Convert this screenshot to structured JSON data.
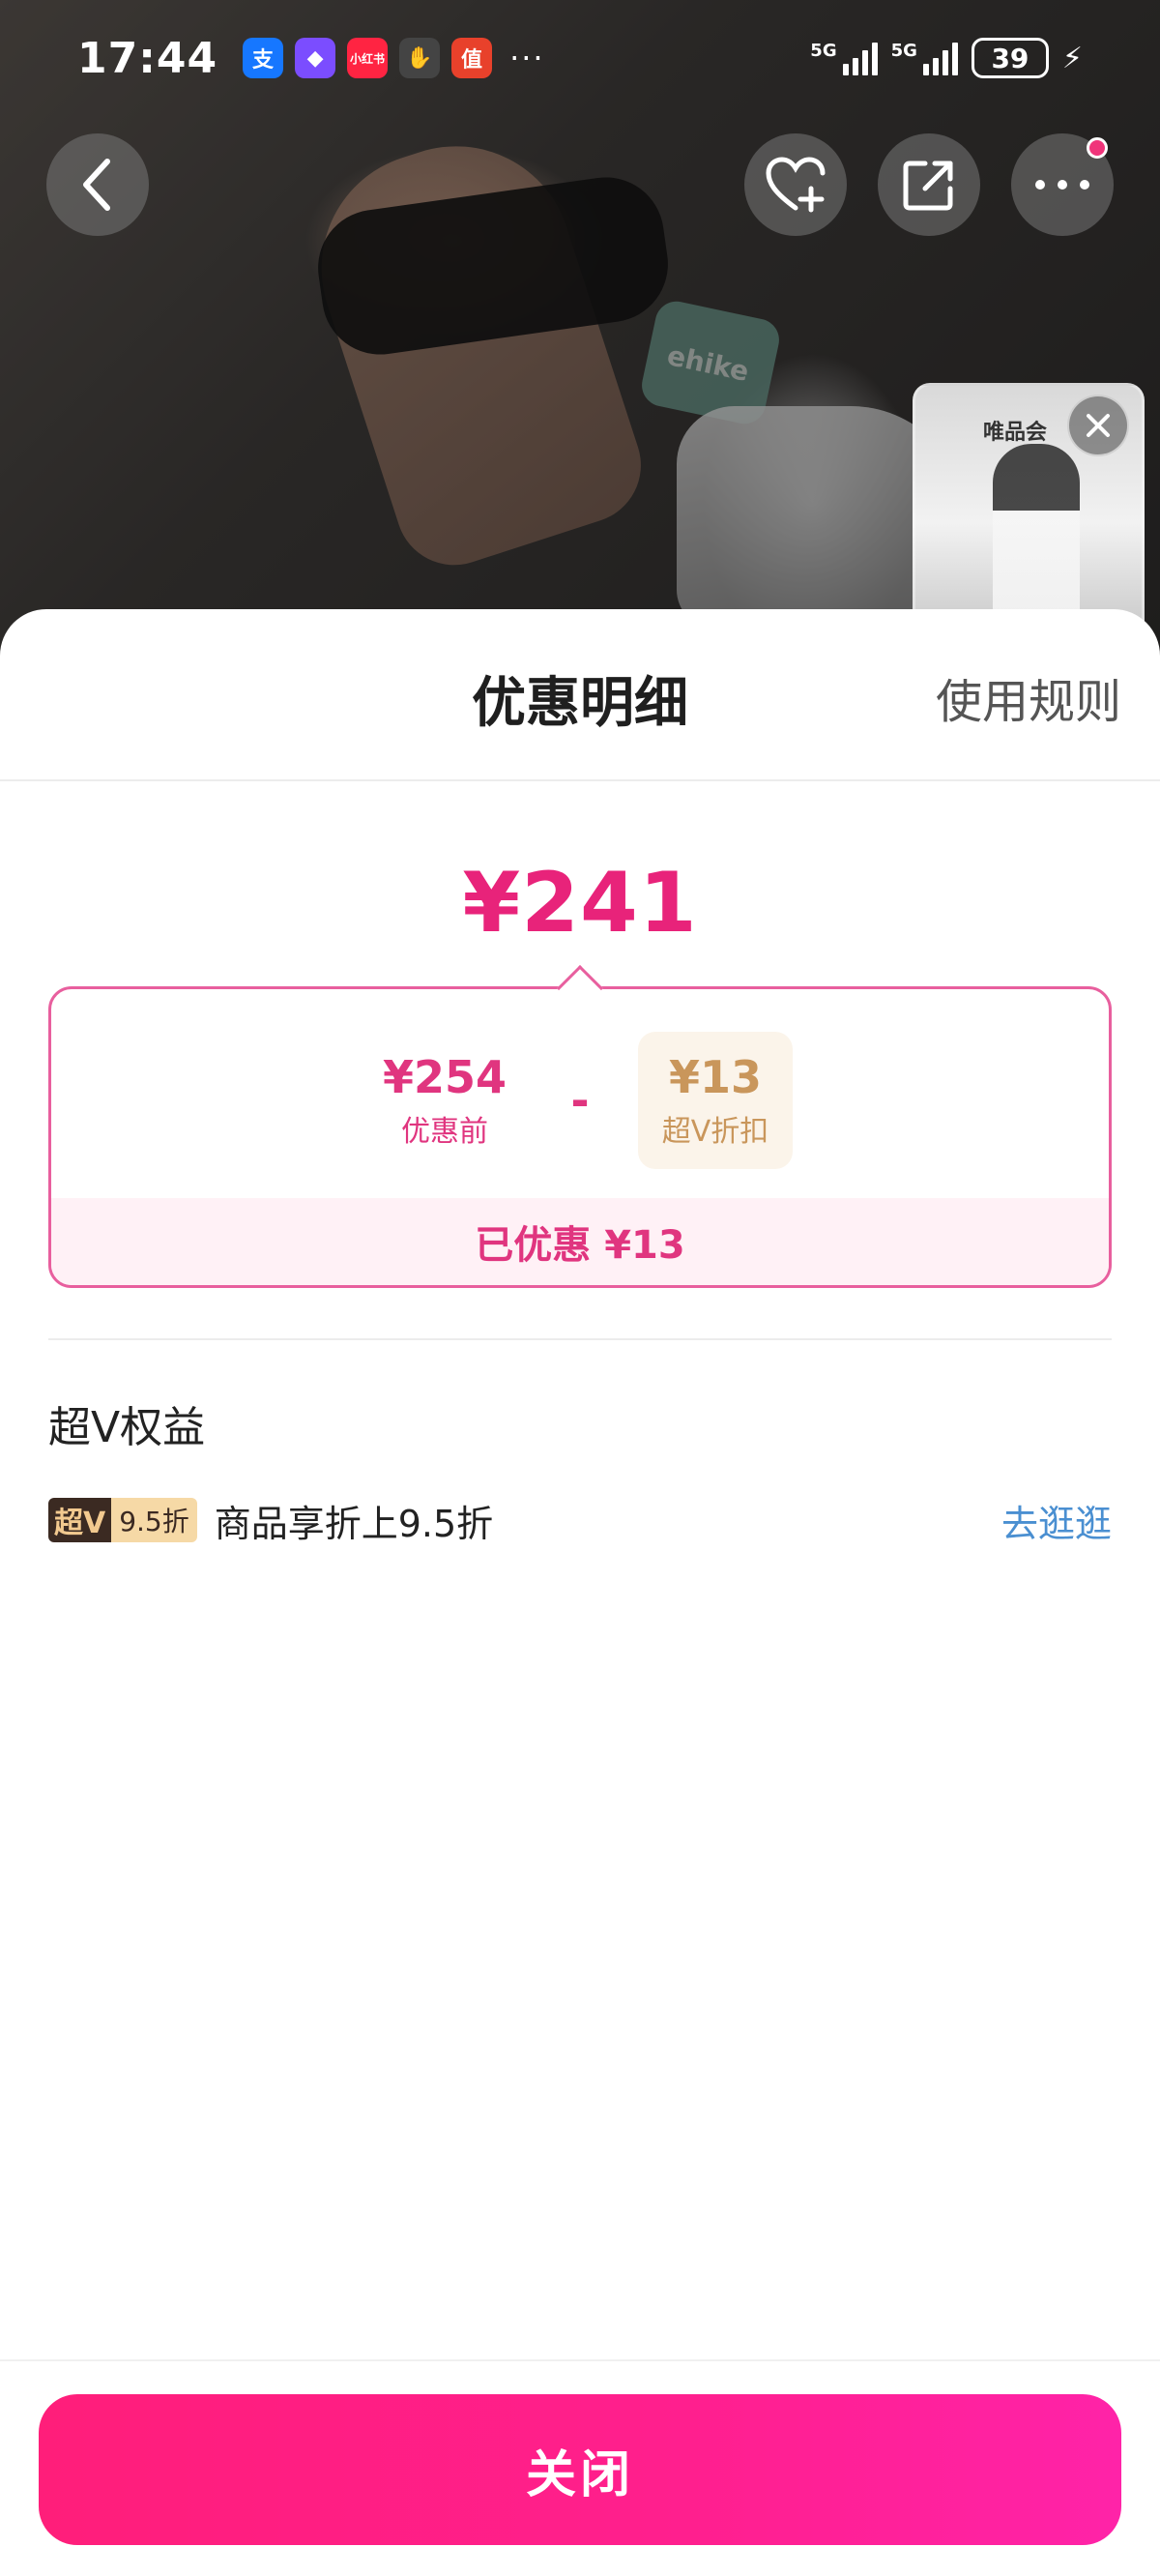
{
  "status_bar": {
    "time": "17:44",
    "apps": [
      {
        "name": "alipay-icon",
        "glyph": "支",
        "color": "#1677ff"
      },
      {
        "name": "purple-app-icon",
        "glyph": "◆",
        "color": "#7b4dff"
      },
      {
        "name": "xiaohongshu-icon",
        "glyph": "小红书",
        "color": "#ff2442"
      },
      {
        "name": "hand-app-icon",
        "glyph": "✋",
        "color": "#444444"
      },
      {
        "name": "zhide-icon",
        "glyph": "值",
        "color": "#e8412b"
      }
    ],
    "more": "···",
    "signal_labels": [
      "5G",
      "5G"
    ],
    "battery": "39"
  },
  "mini_video": {
    "label": "唯品会"
  },
  "photo": {
    "sock_text": "ehike"
  },
  "sheet": {
    "title": "优惠明细",
    "rules_link": "使用规则",
    "final_price": "¥241",
    "calc": {
      "original_amount": "¥254",
      "original_label": "优惠前",
      "minus": "-",
      "discount_amount": "¥13",
      "discount_label": "超V折扣",
      "saved_text": "已优惠 ¥13"
    },
    "benefits_section_title": "超V权益",
    "benefit": {
      "badge_main": "超V",
      "badge_discount": "9.5折",
      "text": "商品享折上9.5折",
      "link": "去逛逛"
    },
    "close_button": "关闭"
  },
  "colors": {
    "accent_pink": "#e8237a",
    "gold": "#c9965b",
    "link_blue": "#4a8fd1"
  }
}
